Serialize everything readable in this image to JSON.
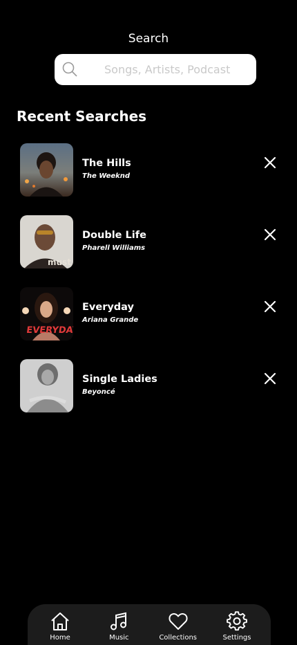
{
  "header": {
    "title": "Search"
  },
  "search": {
    "placeholder": "Songs, Artists, Podcast",
    "icon": "search-icon"
  },
  "recent": {
    "title": "Recent Searches",
    "items": [
      {
        "title": "The Hills",
        "artist": "The Weeknd"
      },
      {
        "title": "Double Life",
        "artist": "Pharell Williams"
      },
      {
        "title": "Everyday",
        "artist": "Ariana Grande"
      },
      {
        "title": "Single Ladies",
        "artist": "Beyoncé"
      }
    ]
  },
  "nav": {
    "items": [
      {
        "label": "Home",
        "icon": "home-icon"
      },
      {
        "label": "Music",
        "icon": "music-note-icon"
      },
      {
        "label": "Collections",
        "icon": "heart-icon"
      },
      {
        "label": "Settings",
        "icon": "gear-icon"
      }
    ]
  },
  "colors": {
    "background": "#000000",
    "nav_background": "#1c1c1c",
    "search_background": "#ffffff"
  }
}
